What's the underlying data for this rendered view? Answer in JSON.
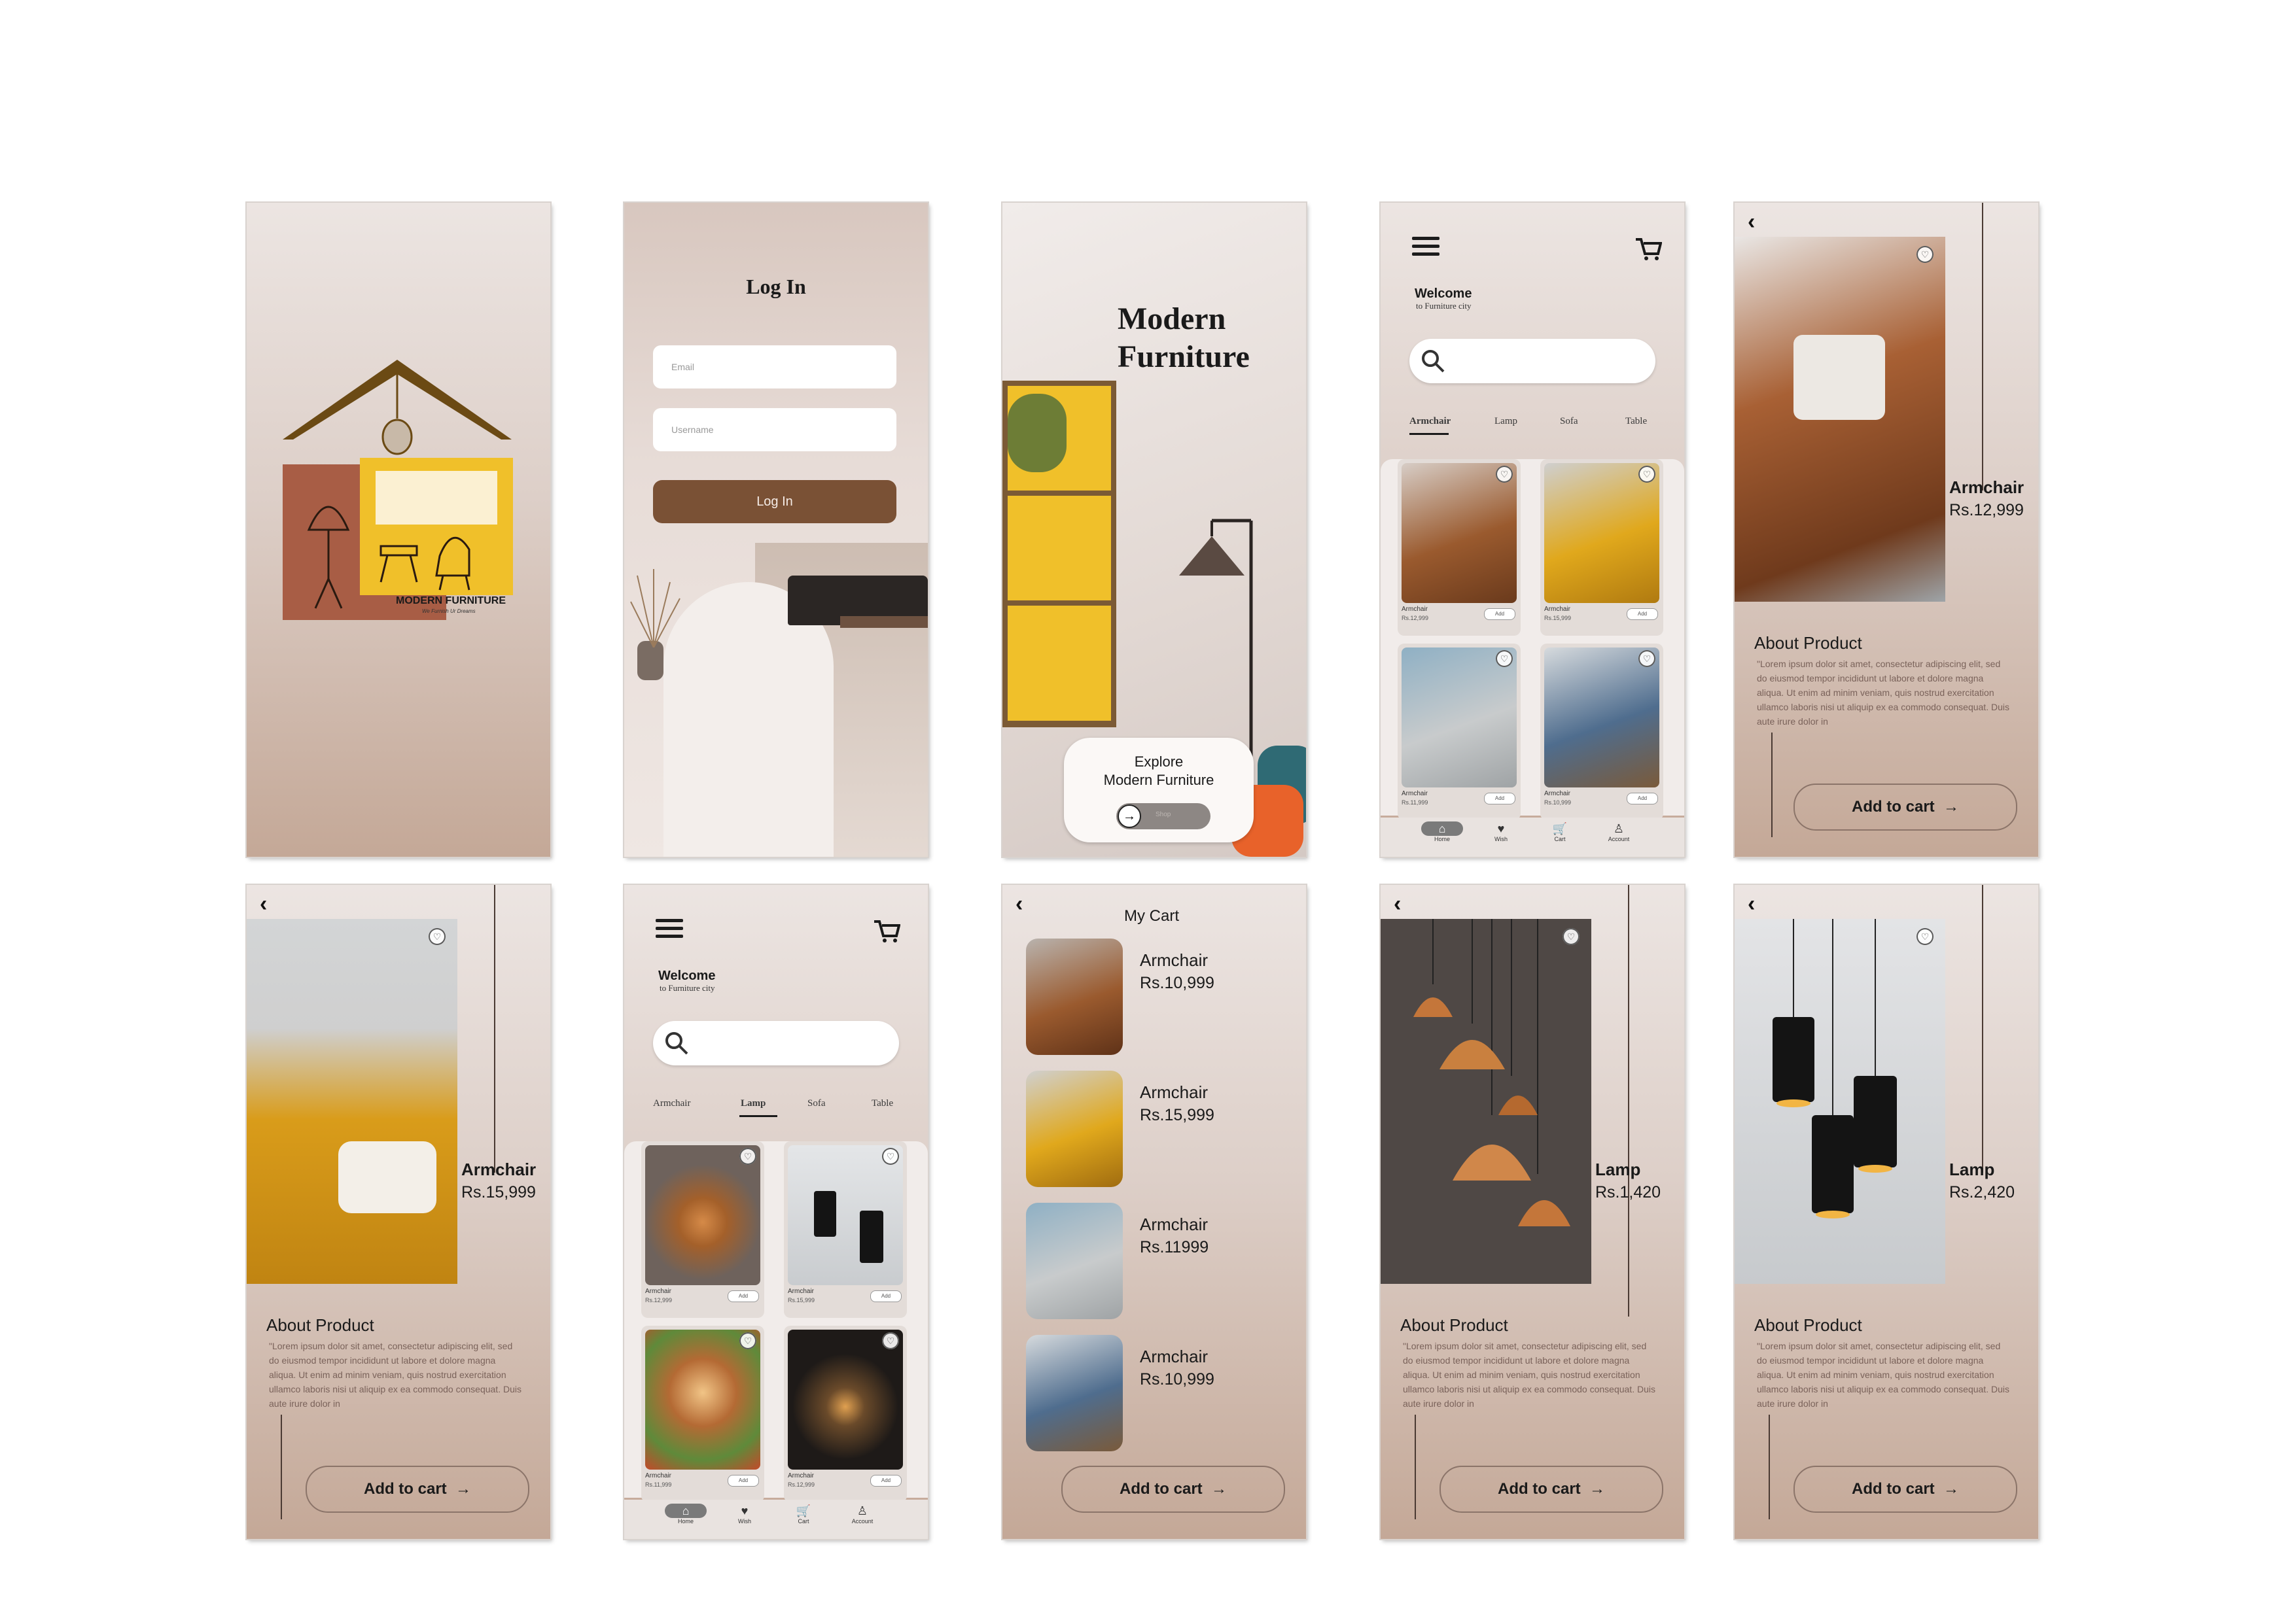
{
  "splash": {
    "brand": "MODERN FURNITURE",
    "tagline": "We Furnish Ur Dreams"
  },
  "login": {
    "title": "Log In",
    "email_placeholder": "Email",
    "username_placeholder": "Username",
    "button": "Log In"
  },
  "intro": {
    "title_line1": "Modern",
    "title_line2": "Furniture",
    "explore_line1": "Explore",
    "explore_line2": "Modern Furniture",
    "slide_label": "Shop"
  },
  "home": {
    "welcome": "Welcome",
    "subtitle": "to Furniture city",
    "tabs": [
      "Armchair",
      "Lamp",
      "Sofa",
      "Table"
    ],
    "nav": [
      "Home",
      "Wish",
      "Cart",
      "Account"
    ],
    "add_label": "Add",
    "armchair_cards": [
      {
        "name": "Armchair",
        "price": "Rs.12,999"
      },
      {
        "name": "Armchair",
        "price": "Rs.15,999"
      },
      {
        "name": "Armchair",
        "price": "Rs.11,999"
      },
      {
        "name": "Armchair",
        "price": "Rs.10,999"
      }
    ],
    "lamp_cards": [
      {
        "name": "Armchair",
        "price": "Rs.12,999"
      },
      {
        "name": "Armchair",
        "price": "Rs.15,999"
      },
      {
        "name": "Armchair",
        "price": "Rs.11,999"
      },
      {
        "name": "Armchair",
        "price": "Rs.12,999"
      }
    ]
  },
  "detail": {
    "about": "About Product",
    "lorem": "\"Lorem ipsum dolor sit amet, consectetur adipiscing elit, sed do eiusmod tempor incididunt ut labore et dolore magna aliqua. Ut enim ad minim veniam, quis nostrud exercitation ullamco laboris nisi ut aliquip ex ea commodo consequat. Duis aute irure dolor in",
    "add_to_cart": "Add to cart",
    "products": [
      {
        "name": "Armchair",
        "price": "Rs.12,999"
      },
      {
        "name": "Armchair",
        "price": "Rs.15,999"
      },
      {
        "name": "Lamp",
        "price": "Rs.1,420"
      },
      {
        "name": "Lamp",
        "price": "Rs.2,420"
      }
    ]
  },
  "cart": {
    "title": "My Cart",
    "items": [
      {
        "name": "Armchair",
        "price": "Rs.10,999"
      },
      {
        "name": "Armchair",
        "price": "Rs.15,999"
      },
      {
        "name": "Armchair",
        "price": "Rs.11999"
      },
      {
        "name": "Armchair",
        "price": "Rs.10,999"
      }
    ],
    "add_to_cart": "Add to cart"
  },
  "colors": {
    "brown": "#7a5135",
    "mustard": "#f0c02a",
    "terracotta": "#a85d45",
    "leather": "#8b4a28",
    "copper": "#c4763a"
  }
}
